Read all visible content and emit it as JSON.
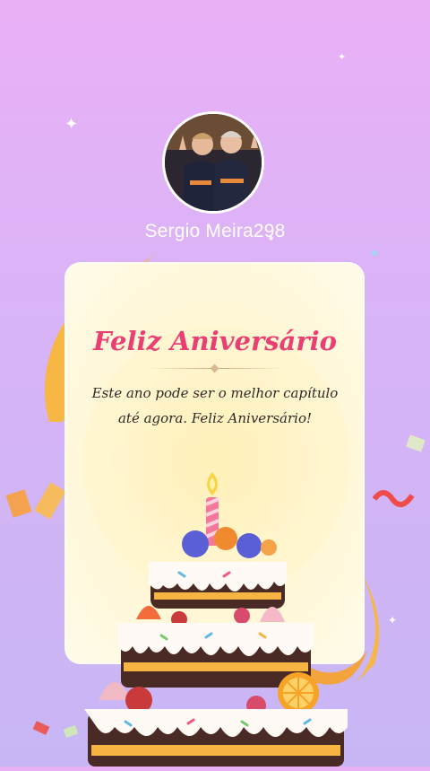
{
  "profile": {
    "username": "Sergio Meira298",
    "avatar_alt": "profile-photo"
  },
  "card": {
    "title": "Feliz Aniversário",
    "message": "Este ano pode ser o melhor capítulo até agora. Feliz Aniversário!"
  },
  "colors": {
    "background_top": "#eab0f6",
    "background_bottom": "#c8b6f4",
    "title_color": "#ea3f73",
    "card_background": "#fff7d6"
  },
  "decorations": {
    "sparkle_icon": "sparkle-icon",
    "cake_icon": "birthday-cake-icon",
    "candle_icon": "candle-icon"
  }
}
